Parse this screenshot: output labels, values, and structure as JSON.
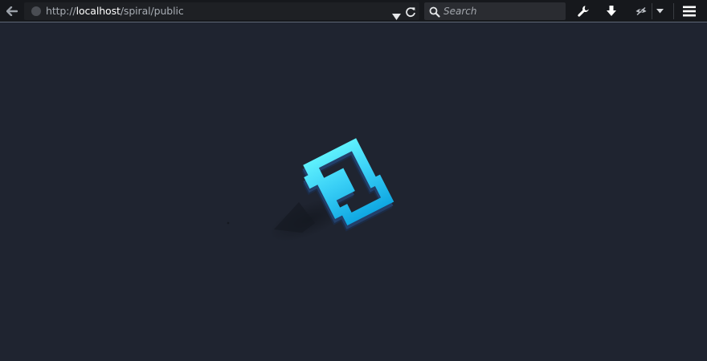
{
  "browser": {
    "url": {
      "scheme": "http://",
      "host": "localhost",
      "path": "/spiral/public"
    },
    "search": {
      "placeholder": "Search"
    },
    "icons": {
      "back": "back-arrow-icon",
      "site": "globe-icon",
      "history_dropdown": "dropdown-triangle-icon",
      "reload": "reload-icon",
      "search": "magnifier-icon",
      "tools": "wrench-icon",
      "downloads": "download-arrow-icon",
      "addon": "eye-addon-icon",
      "addon_menu": "chevron-down-icon",
      "menu": "hamburger-menu-icon"
    }
  },
  "colors": {
    "toolbar_bg": "#16181c",
    "page_bg": "#1f2430",
    "logo_light": "#5ff1fd",
    "logo_dark": "#0fa7e2"
  }
}
